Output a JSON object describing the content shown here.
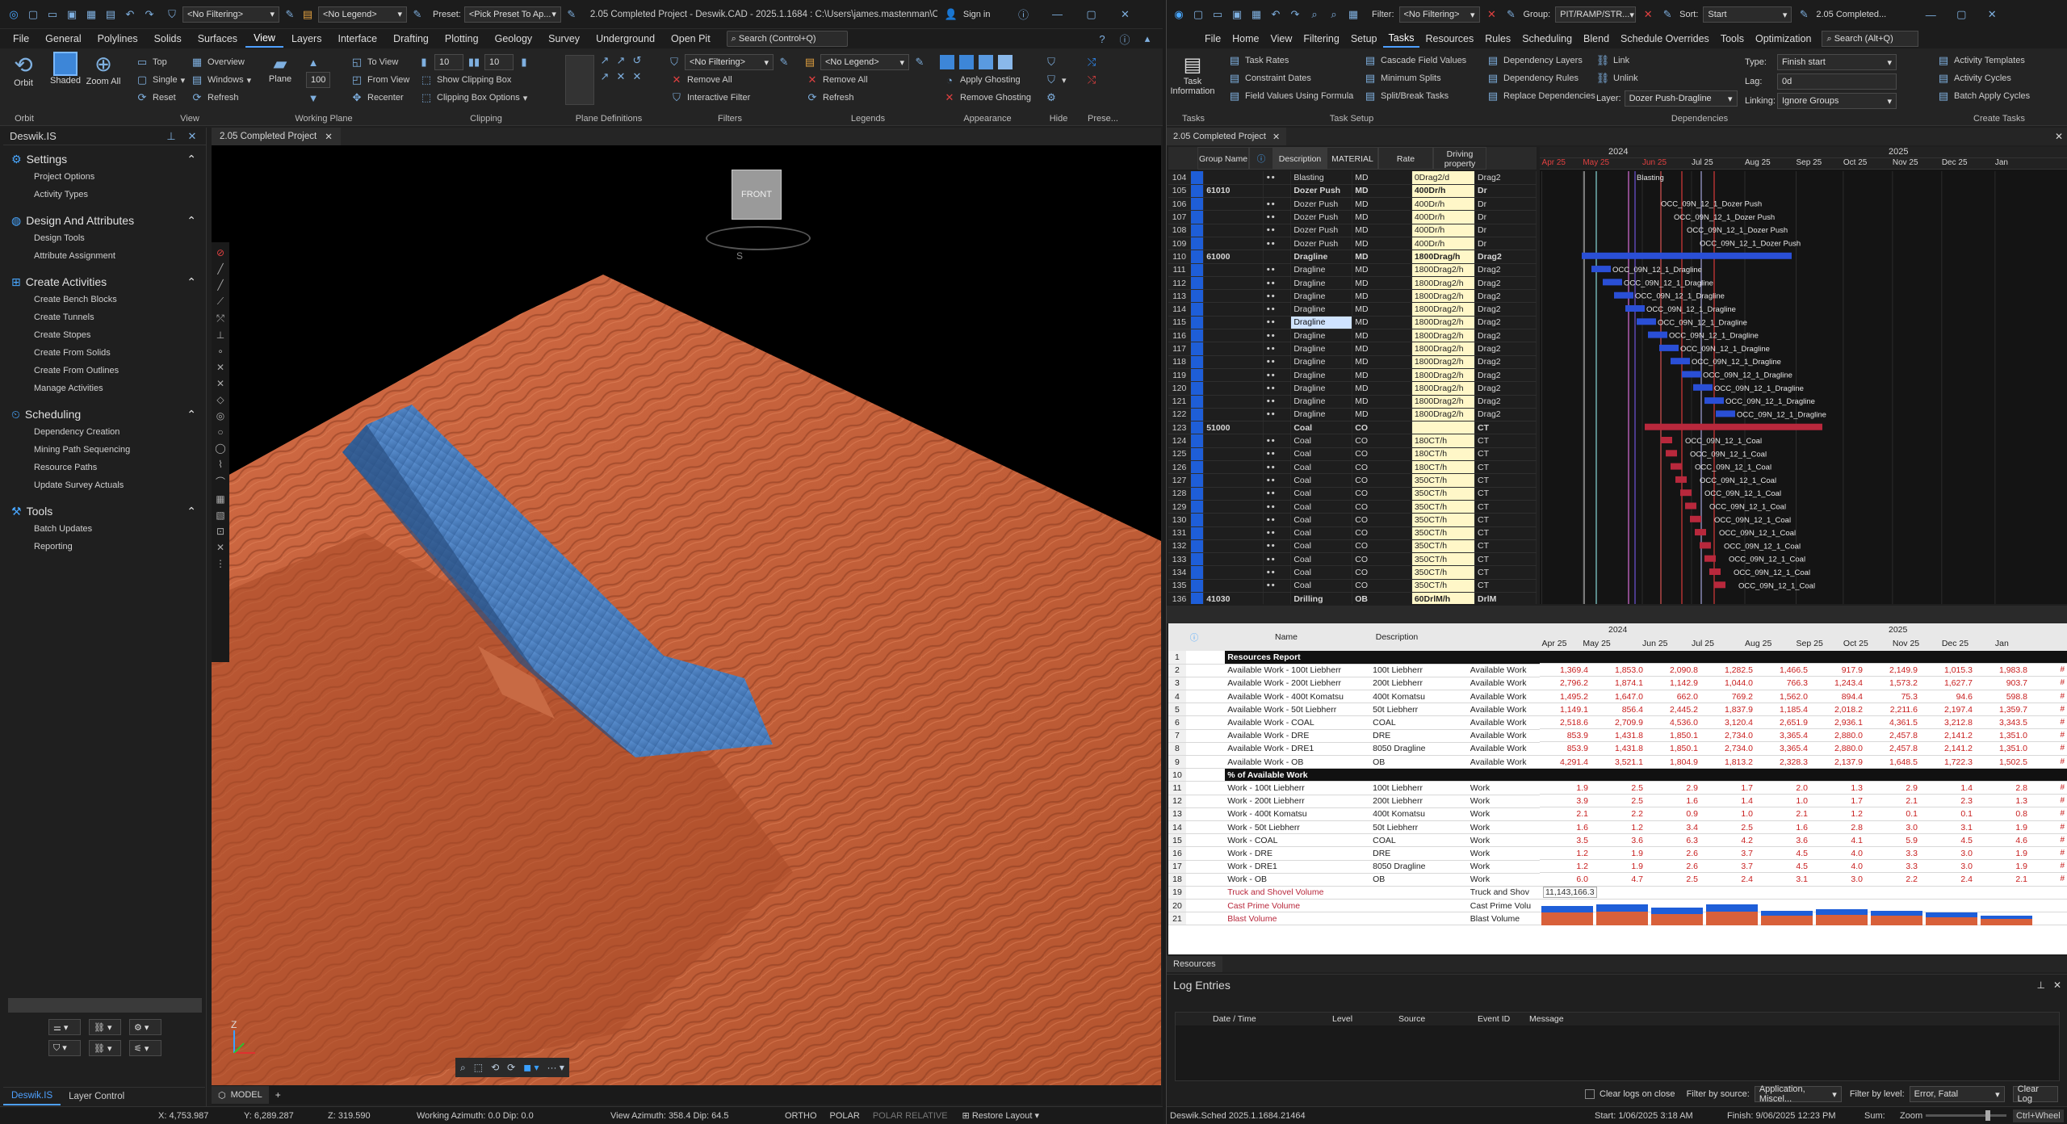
{
  "cad": {
    "title": "2.05 Completed Project - Deswik.CAD - 2025.1.1684 : C:\\Users\\james.mastenman\\One...",
    "sign_in": "Sign in",
    "filter": "<No Filtering>",
    "legend": "<No Legend>",
    "preset_label": "Preset:",
    "preset": "<Pick Preset To Ap...",
    "search": "Search (Control+Q)",
    "menu": [
      "File",
      "General",
      "Polylines",
      "Solids",
      "Surfaces",
      "View",
      "Layers",
      "Interface",
      "Drafting",
      "Plotting",
      "Geology",
      "Survey",
      "Underground",
      "Open Pit"
    ],
    "active_menu": "View",
    "ribbon": {
      "orbit": "Orbit",
      "shaded": "Shaded",
      "zoom_all": "Zoom All",
      "top": "Top",
      "single": "Single",
      "reset": "Reset",
      "overview": "Overview",
      "windows": "Windows",
      "refresh": "Refresh",
      "plane": "Plane",
      "to_view": "To View",
      "from_view": "From View",
      "recenter": "Recenter",
      "clip_val1": "10",
      "clip_val2": "10",
      "clip_val3": "100",
      "show_clipping_box": "Show Clipping Box",
      "clipping_box_options": "Clipping Box Options",
      "filter_no": "<No Filtering>",
      "remove_all": "Remove All",
      "interactive_filter": "Interactive Filter",
      "legend_no": "<No Legend>",
      "remove_all2": "Remove All",
      "refresh2": "Refresh",
      "apply_ghosting": "Apply Ghosting",
      "remove_ghosting": "Remove Ghosting",
      "groups": [
        "Orbit",
        "View",
        "Working Plane",
        "Clipping",
        "Plane Definitions",
        "Filters",
        "Legends",
        "Appearance",
        "Hide",
        "Prese..."
      ]
    },
    "side_title": "Deswik.IS",
    "sections": [
      {
        "title": "Settings",
        "items": [
          "Project Options",
          "Activity Types"
        ]
      },
      {
        "title": "Design And Attributes",
        "items": [
          "Design Tools",
          "Attribute Assignment"
        ]
      },
      {
        "title": "Create Activities",
        "items": [
          "Create Bench Blocks",
          "Create Tunnels",
          "Create Stopes",
          "Create From Solids",
          "Create From Outlines",
          "Manage Activities"
        ]
      },
      {
        "title": "Scheduling",
        "items": [
          "Dependency Creation",
          "Mining Path Sequencing",
          "Resource Paths",
          "Update Survey Actuals"
        ]
      },
      {
        "title": "Tools",
        "items": [
          "Batch Updates",
          "Reporting"
        ]
      }
    ],
    "side_tabs": [
      "Deswik.IS",
      "Layer Control"
    ],
    "doc_tab": "2.05 Completed Project",
    "model_tab": "MODEL",
    "cube_label": "FRONT",
    "cube_s": "S",
    "axis_z": "Z",
    "status": {
      "x": "X: 4,753.987",
      "y": "Y: 6,289.287",
      "z": "Z: 319.590",
      "working_azimuth": "Working Azimuth: 0.0 Dip: 0.0",
      "view_azimuth": "View Azimuth: 358.4 Dip: 64.5",
      "ortho": "ORTHO",
      "polar": "POLAR",
      "polar_rel": "POLAR RELATIVE",
      "restore": "Restore Layout"
    }
  },
  "sched": {
    "title": "2.05 Completed...",
    "filter_label": "Filter:",
    "filter": "<No Filtering>",
    "group_label": "Group:",
    "group": "PIT/RAMP/STR...",
    "sort_label": "Sort:",
    "sort": "Start",
    "menu": [
      "File",
      "Home",
      "View",
      "Filtering",
      "Setup",
      "Tasks",
      "Resources",
      "Rules",
      "Scheduling",
      "Blend",
      "Schedule Overrides",
      "Tools",
      "Optimization"
    ],
    "active_menu": "Tasks",
    "search": "Search (Alt+Q)",
    "ribbon": {
      "task_information": "Task Information",
      "task_rates": "Task Rates",
      "constraint_dates": "Constraint Dates",
      "field_values_formula": "Field Values Using Formula",
      "cascade": "Cascade Field Values",
      "minimum_splits": "Minimum Splits",
      "split_break": "Split/Break Tasks",
      "dep_layers": "Dependency Layers",
      "dep_rules": "Dependency Rules",
      "replace_deps": "Replace Dependencies",
      "link": "Link",
      "unlink": "Unlink",
      "layer_label": "Layer:",
      "layer": "Dozer Push-Dragline",
      "type_label": "Type:",
      "type": "Finish start",
      "lag_label": "Lag:",
      "lag": "0d",
      "linking_label": "Linking:",
      "linking": "Ignore Groups",
      "activity_templates": "Activity Templates",
      "activity_cycles": "Activity Cycles",
      "batch_apply": "Batch Apply Cycles",
      "groups": [
        "Tasks",
        "Task Setup",
        "Dependencies",
        "Create Tasks"
      ]
    },
    "doc_tab": "2.05 Completed Project",
    "grid_headers": [
      "Group Name",
      "Description",
      "MATERIAL",
      "Rate",
      "Driving property"
    ],
    "gantt_years": [
      "2024",
      "2025"
    ],
    "gantt_months": [
      "Apr 25",
      "May 25",
      "Jun 25",
      "Jul 25",
      "Aug 25",
      "Sep 25",
      "Oct 25",
      "Nov 25",
      "Dec 25",
      "Jan"
    ],
    "rows": [
      {
        "n": "104",
        "g": "",
        "d": "Blasting",
        "m": "MD",
        "r": "0Drag2/d",
        "p": "Drag2",
        "bold": false
      },
      {
        "n": "105",
        "g": "61010",
        "d": "Dozer Push",
        "m": "MD",
        "r": "400Dr/h",
        "p": "Dr",
        "bold": true
      },
      {
        "n": "106",
        "g": "",
        "d": "Dozer Push",
        "m": "MD",
        "r": "400Dr/h",
        "p": "Dr",
        "bold": false
      },
      {
        "n": "107",
        "g": "",
        "d": "Dozer Push",
        "m": "MD",
        "r": "400Dr/h",
        "p": "Dr",
        "bold": false
      },
      {
        "n": "108",
        "g": "",
        "d": "Dozer Push",
        "m": "MD",
        "r": "400Dr/h",
        "p": "Dr",
        "bold": false
      },
      {
        "n": "109",
        "g": "",
        "d": "Dozer Push",
        "m": "MD",
        "r": "400Dr/h",
        "p": "Dr",
        "bold": false
      },
      {
        "n": "110",
        "g": "61000",
        "d": "Dragline",
        "m": "MD",
        "r": "1800Drag/h",
        "p": "Drag2",
        "bold": true
      },
      {
        "n": "111",
        "g": "",
        "d": "Dragline",
        "m": "MD",
        "r": "1800Drag2/h",
        "p": "Drag2",
        "bold": false
      },
      {
        "n": "112",
        "g": "",
        "d": "Dragline",
        "m": "MD",
        "r": "1800Drag2/h",
        "p": "Drag2",
        "bold": false
      },
      {
        "n": "113",
        "g": "",
        "d": "Dragline",
        "m": "MD",
        "r": "1800Drag2/h",
        "p": "Drag2",
        "bold": false
      },
      {
        "n": "114",
        "g": "",
        "d": "Dragline",
        "m": "MD",
        "r": "1800Drag2/h",
        "p": "Drag2",
        "bold": false
      },
      {
        "n": "115",
        "g": "",
        "d": "Dragline",
        "m": "MD",
        "r": "1800Drag2/h",
        "p": "Drag2",
        "bold": false
      },
      {
        "n": "116",
        "g": "",
        "d": "Dragline",
        "m": "MD",
        "r": "1800Drag2/h",
        "p": "Drag2",
        "bold": false
      },
      {
        "n": "117",
        "g": "",
        "d": "Dragline",
        "m": "MD",
        "r": "1800Drag2/h",
        "p": "Drag2",
        "bold": false
      },
      {
        "n": "118",
        "g": "",
        "d": "Dragline",
        "m": "MD",
        "r": "1800Drag2/h",
        "p": "Drag2",
        "bold": false
      },
      {
        "n": "119",
        "g": "",
        "d": "Dragline",
        "m": "MD",
        "r": "1800Drag2/h",
        "p": "Drag2",
        "bold": false
      },
      {
        "n": "120",
        "g": "",
        "d": "Dragline",
        "m": "MD",
        "r": "1800Drag2/h",
        "p": "Drag2",
        "bold": false
      },
      {
        "n": "121",
        "g": "",
        "d": "Dragline",
        "m": "MD",
        "r": "1800Drag2/h",
        "p": "Drag2",
        "bold": false
      },
      {
        "n": "122",
        "g": "",
        "d": "Dragline",
        "m": "MD",
        "r": "1800Drag2/h",
        "p": "Drag2",
        "bold": false
      },
      {
        "n": "123",
        "g": "51000",
        "d": "Coal",
        "m": "CO",
        "r": "",
        "p": "CT",
        "bold": true
      },
      {
        "n": "124",
        "g": "",
        "d": "Coal",
        "m": "CO",
        "r": "180CT/h",
        "p": "CT",
        "bold": false
      },
      {
        "n": "125",
        "g": "",
        "d": "Coal",
        "m": "CO",
        "r": "180CT/h",
        "p": "CT",
        "bold": false
      },
      {
        "n": "126",
        "g": "",
        "d": "Coal",
        "m": "CO",
        "r": "180CT/h",
        "p": "CT",
        "bold": false
      },
      {
        "n": "127",
        "g": "",
        "d": "Coal",
        "m": "CO",
        "r": "350CT/h",
        "p": "CT",
        "bold": false
      },
      {
        "n": "128",
        "g": "",
        "d": "Coal",
        "m": "CO",
        "r": "350CT/h",
        "p": "CT",
        "bold": false
      },
      {
        "n": "129",
        "g": "",
        "d": "Coal",
        "m": "CO",
        "r": "350CT/h",
        "p": "CT",
        "bold": false
      },
      {
        "n": "130",
        "g": "",
        "d": "Coal",
        "m": "CO",
        "r": "350CT/h",
        "p": "CT",
        "bold": false
      },
      {
        "n": "131",
        "g": "",
        "d": "Coal",
        "m": "CO",
        "r": "350CT/h",
        "p": "CT",
        "bold": false
      },
      {
        "n": "132",
        "g": "",
        "d": "Coal",
        "m": "CO",
        "r": "350CT/h",
        "p": "CT",
        "bold": false
      },
      {
        "n": "133",
        "g": "",
        "d": "Coal",
        "m": "CO",
        "r": "350CT/h",
        "p": "CT",
        "bold": false
      },
      {
        "n": "134",
        "g": "",
        "d": "Coal",
        "m": "CO",
        "r": "350CT/h",
        "p": "CT",
        "bold": false
      },
      {
        "n": "135",
        "g": "",
        "d": "Coal",
        "m": "CO",
        "r": "350CT/h",
        "p": "CT",
        "bold": false
      },
      {
        "n": "136",
        "g": "41030",
        "d": "Drilling",
        "m": "OB",
        "r": "60DrlM/h",
        "p": "DrlM",
        "bold": true
      }
    ],
    "gantt_labels": [
      {
        "row": 0,
        "t": "Blasting"
      },
      {
        "row": 2,
        "t": "OCC_09N_12_1_Dozer Push"
      },
      {
        "row": 3,
        "t": "OCC_09N_12_1_Dozer Push"
      },
      {
        "row": 4,
        "t": "OCC_09N_12_1_Dozer Push"
      },
      {
        "row": 5,
        "t": "OCC_09N_12_1_Dozer Push"
      },
      {
        "row": 7,
        "t": "OCC_09N_12_1_Dragline"
      },
      {
        "row": 8,
        "t": "OCC_09N_12_1_Dragline"
      },
      {
        "row": 9,
        "t": "OCC_09N_12_1_Dragline"
      },
      {
        "row": 10,
        "t": "OCC_09N_12_1_Dragline"
      },
      {
        "row": 11,
        "t": "OCC_09N_12_1_Dragline"
      },
      {
        "row": 12,
        "t": "OCC_09N_12_1_Dragline"
      },
      {
        "row": 13,
        "t": "OCC_09N_12_1_Dragline"
      },
      {
        "row": 14,
        "t": "OCC_09N_12_1_Dragline"
      },
      {
        "row": 15,
        "t": "OCC_09N_12_1_Dragline"
      },
      {
        "row": 16,
        "t": "OCC_09N_12_1_Dragline"
      },
      {
        "row": 17,
        "t": "OCC_09N_12_1_Dragline"
      },
      {
        "row": 18,
        "t": "OCC_09N_12_1_Dragline"
      },
      {
        "row": 20,
        "t": "OCC_09N_12_1_Coal"
      },
      {
        "row": 21,
        "t": "OCC_09N_12_1_Coal"
      },
      {
        "row": 22,
        "t": "OCC_09N_12_1_Coal"
      },
      {
        "row": 23,
        "t": "OCC_09N_12_1_Coal"
      },
      {
        "row": 24,
        "t": "OCC_09N_12_1_Coal"
      },
      {
        "row": 25,
        "t": "OCC_09N_12_1_Coal"
      },
      {
        "row": 26,
        "t": "OCC_09N_12_1_Coal"
      },
      {
        "row": 27,
        "t": "OCC_09N_12_1_Coal"
      },
      {
        "row": 28,
        "t": "OCC_09N_12_1_Coal"
      },
      {
        "row": 29,
        "t": "OCC_09N_12_1_Coal"
      },
      {
        "row": 30,
        "t": "OCC_09N_12_1_Coal"
      },
      {
        "row": 31,
        "t": "OCC_09N_12_1_Coal"
      }
    ],
    "res_headers": [
      "Name",
      "Description"
    ],
    "res_months": [
      "Apr 25",
      "May 25",
      "Jun 25",
      "Jul 25",
      "Aug 25",
      "Sep 25",
      "Oct 25",
      "Nov 25",
      "Dec 25",
      "Jan"
    ],
    "res_rows": [
      {
        "n": "1",
        "name": "Resources Report",
        "desc": "",
        "type": "",
        "vals": [],
        "header": true
      },
      {
        "n": "2",
        "name": "Available Work - 100t Liebherr",
        "desc": "100t Liebherr",
        "type": "Available Work",
        "vals": [
          "1,369.4",
          "1,853.0",
          "2,090.8",
          "1,282.5",
          "1,466.5",
          "917.9",
          "2,149.9",
          "1,015.3",
          "1,983.8"
        ]
      },
      {
        "n": "3",
        "name": "Available Work - 200t Liebherr",
        "desc": "200t Liebherr",
        "type": "Available Work",
        "vals": [
          "2,796.2",
          "1,874.1",
          "1,142.9",
          "1,044.0",
          "766.3",
          "1,243.4",
          "1,573.2",
          "1,627.7",
          "903.7"
        ]
      },
      {
        "n": "4",
        "name": "Available Work - 400t Komatsu",
        "desc": "400t Komatsu",
        "type": "Available Work",
        "vals": [
          "1,495.2",
          "1,647.0",
          "662.0",
          "769.2",
          "1,562.0",
          "894.4",
          "75.3",
          "94.6",
          "598.8"
        ]
      },
      {
        "n": "5",
        "name": "Available Work - 50t Liebherr",
        "desc": "50t Liebherr",
        "type": "Available Work",
        "vals": [
          "1,149.1",
          "856.4",
          "2,445.2",
          "1,837.9",
          "1,185.4",
          "2,018.2",
          "2,211.6",
          "2,197.4",
          "1,359.7"
        ]
      },
      {
        "n": "6",
        "name": "Available Work - COAL",
        "desc": "COAL",
        "type": "Available Work",
        "vals": [
          "2,518.6",
          "2,709.9",
          "4,536.0",
          "3,120.4",
          "2,651.9",
          "2,936.1",
          "4,361.5",
          "3,212.8",
          "3,343.5"
        ]
      },
      {
        "n": "7",
        "name": "Available Work - DRE",
        "desc": "DRE",
        "type": "Available Work",
        "vals": [
          "853.9",
          "1,431.8",
          "1,850.1",
          "2,734.0",
          "3,365.4",
          "2,880.0",
          "2,457.8",
          "2,141.2",
          "1,351.0"
        ]
      },
      {
        "n": "8",
        "name": "Available Work - DRE1",
        "desc": "8050 Dragline",
        "type": "Available Work",
        "vals": [
          "853.9",
          "1,431.8",
          "1,850.1",
          "2,734.0",
          "3,365.4",
          "2,880.0",
          "2,457.8",
          "2,141.2",
          "1,351.0"
        ]
      },
      {
        "n": "9",
        "name": "Available Work - OB",
        "desc": "OB",
        "type": "Available Work",
        "vals": [
          "4,291.4",
          "3,521.1",
          "1,804.9",
          "1,813.2",
          "2,328.3",
          "2,137.9",
          "1,648.5",
          "1,722.3",
          "1,502.5"
        ]
      },
      {
        "n": "10",
        "name": "% of Available Work",
        "desc": "",
        "type": "",
        "vals": [],
        "header": true
      },
      {
        "n": "11",
        "name": "Work - 100t Liebherr",
        "desc": "100t Liebherr",
        "type": "Work",
        "vals": [
          "1.9",
          "2.5",
          "2.9",
          "1.7",
          "2.0",
          "1.3",
          "2.9",
          "1.4",
          "2.8"
        ]
      },
      {
        "n": "12",
        "name": "Work - 200t Liebherr",
        "desc": "200t Liebherr",
        "type": "Work",
        "vals": [
          "3.9",
          "2.5",
          "1.6",
          "1.4",
          "1.0",
          "1.7",
          "2.1",
          "2.3",
          "1.3"
        ]
      },
      {
        "n": "13",
        "name": "Work - 400t Komatsu",
        "desc": "400t Komatsu",
        "type": "Work",
        "vals": [
          "2.1",
          "2.2",
          "0.9",
          "1.0",
          "2.1",
          "1.2",
          "0.1",
          "0.1",
          "0.8"
        ]
      },
      {
        "n": "14",
        "name": "Work - 50t Liebherr",
        "desc": "50t Liebherr",
        "type": "Work",
        "vals": [
          "1.6",
          "1.2",
          "3.4",
          "2.5",
          "1.6",
          "2.8",
          "3.0",
          "3.1",
          "1.9"
        ]
      },
      {
        "n": "15",
        "name": "Work - COAL",
        "desc": "COAL",
        "type": "Work",
        "vals": [
          "3.5",
          "3.6",
          "6.3",
          "4.2",
          "3.6",
          "4.1",
          "5.9",
          "4.5",
          "4.6"
        ]
      },
      {
        "n": "16",
        "name": "Work - DRE",
        "desc": "DRE",
        "type": "Work",
        "vals": [
          "1.2",
          "1.9",
          "2.6",
          "3.7",
          "4.5",
          "4.0",
          "3.3",
          "3.0",
          "1.9"
        ]
      },
      {
        "n": "17",
        "name": "Work - DRE1",
        "desc": "8050 Dragline",
        "type": "Work",
        "vals": [
          "1.2",
          "1.9",
          "2.6",
          "3.7",
          "4.5",
          "4.0",
          "3.3",
          "3.0",
          "1.9"
        ]
      },
      {
        "n": "18",
        "name": "Work - OB",
        "desc": "OB",
        "type": "Work",
        "vals": [
          "6.0",
          "4.7",
          "2.5",
          "2.4",
          "3.1",
          "3.0",
          "2.2",
          "2.4",
          "2.1"
        ]
      },
      {
        "n": "19",
        "name": "Truck and Shovel Volume",
        "desc": "",
        "type": "Truck and Shov",
        "vals": [
          "11,143,166.3"
        ]
      },
      {
        "n": "20",
        "name": "Cast Prime Volume",
        "desc": "",
        "type": "Cast Prime Volu",
        "vals": []
      },
      {
        "n": "21",
        "name": "Blast Volume",
        "desc": "",
        "type": "Blast Volume",
        "vals": []
      }
    ],
    "res_tab": "Resources",
    "log_title": "Log Entries",
    "log_headers": [
      "Date / Time",
      "Level",
      "Source",
      "Event ID",
      "Message"
    ],
    "clear_on_close": "Clear logs on close",
    "filter_source_label": "Filter by source:",
    "filter_source": "Application, Miscel...",
    "filter_level_label": "Filter by level:",
    "filter_level": "Error, Fatal",
    "clear_log": "Clear Log",
    "status": {
      "version": "Deswik.Sched 2025.1.1684.21464",
      "start": "Start: 1/06/2025 3:18 AM",
      "finish": "Finish: 9/06/2025 12:23 PM",
      "sum": "Sum:",
      "zoom": "Zoom",
      "ctrl": "Ctrl+Wheel"
    }
  },
  "colors": {
    "terrain": "#c8643f",
    "block": "#4a7fbf",
    "bar_blue": "#2a4fd6",
    "bar_red": "#b8283c",
    "accent": "#4ea0ff"
  }
}
